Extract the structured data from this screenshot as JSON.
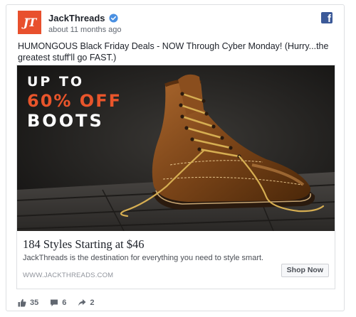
{
  "post": {
    "page_name": "JackThreads",
    "logo_text": "JT",
    "timestamp": "about 11 months ago",
    "text": "HUMONGOUS Black Friday Deals - NOW Through Cyber Monday! (Hurry...the greatest stuff'll go FAST.)"
  },
  "ad": {
    "image_headline": [
      "UP TO",
      "60% OFF",
      "BOOTS"
    ],
    "title": "184 Styles Starting at $46",
    "description": "JackThreads is the destination for everything you need to style smart.",
    "domain": "WWW.JACKTHREADS.COM",
    "cta_label": "Shop Now"
  },
  "engagement": {
    "likes": "35",
    "comments": "6",
    "shares": "2"
  },
  "colors": {
    "brand_orange": "#e8502d",
    "facebook_blue": "#3b5998",
    "verified_blue": "#4a90e2"
  },
  "icons": [
    "verified-badge-icon",
    "facebook-icon",
    "like-icon",
    "comment-icon",
    "share-icon"
  ]
}
